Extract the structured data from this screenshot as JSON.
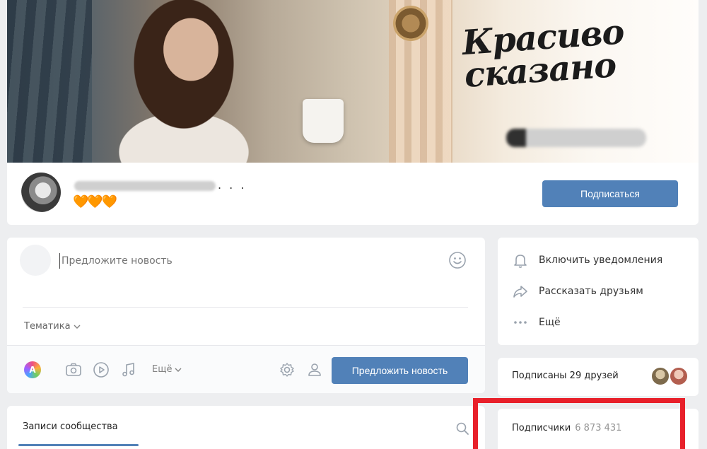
{
  "header": {
    "cover_title": "Красиво сказано",
    "group_name_suffix": ". . .",
    "status": "🧡🧡🧡",
    "subscribe_label": "Подписаться"
  },
  "composer": {
    "placeholder": "Предложите новость",
    "topic_label": "Тематика",
    "more_label": "Ещё",
    "submit_label": "Предложить новость"
  },
  "actions": {
    "items": [
      {
        "label": "Включить уведомления",
        "icon": "bell-icon"
      },
      {
        "label": "Рассказать друзьям",
        "icon": "share-arrow-icon"
      },
      {
        "label": "Ещё",
        "icon": "more-dots-icon"
      }
    ]
  },
  "friends": {
    "label": "Подписаны 29 друзей"
  },
  "wall": {
    "tab_label": "Записи сообщества"
  },
  "followers": {
    "label": "Подписчики",
    "count": "6 873 431"
  },
  "colors": {
    "accent": "#5181b8",
    "highlight": "#e8202a",
    "page_bg": "#edeef0"
  }
}
